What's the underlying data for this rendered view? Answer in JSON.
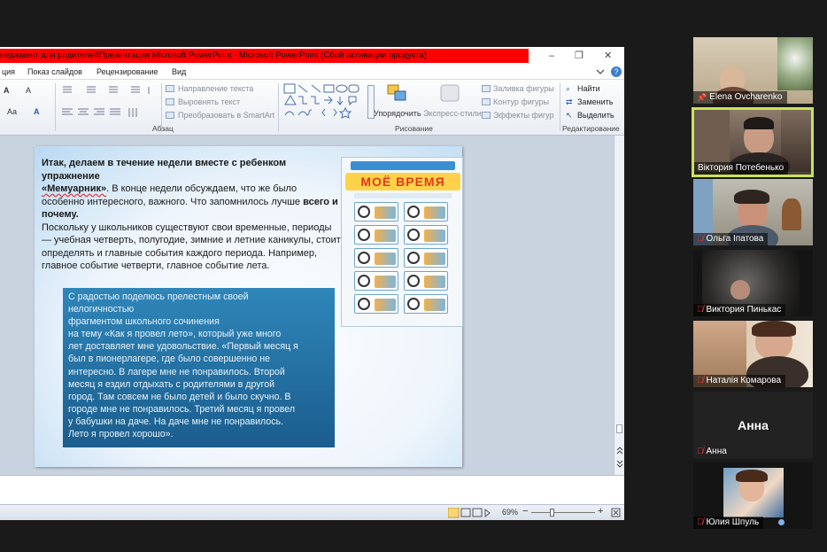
{
  "window": {
    "title": "неджмент для родителейПрезентация Microsoft PowerPoint  -  Microsoft PowerPoint (Сбой активации продукта)",
    "minimize": "–",
    "restore": "❐",
    "close": "✕",
    "help": "?"
  },
  "menu": {
    "items": [
      "ция",
      "Показ слайдов",
      "Рецензирование",
      "Вид"
    ]
  },
  "ribbon": {
    "text_direction": "Направление текста",
    "align_text": "Выровнять текст",
    "convert_smartart": "Преобразовать в SmartArt",
    "paragraph_group": "Абзац",
    "arrange": "Упорядочить",
    "quick_styles": "Экспресс-стили",
    "shape_fill": "Заливка фигуры",
    "shape_outline": "Контур фигуры",
    "shape_effects": "Эффекты фигур",
    "drawing_group": "Рисование",
    "find": "Найти",
    "replace": "Заменить",
    "select": "Выделить",
    "editing_group": "Редактирование",
    "font_size_increase": "A",
    "font_size_decrease": "A",
    "font_case": "Aa",
    "clear_format": "A"
  },
  "slide": {
    "para1_a": "Итак, делаем в течение недели вместе с ребенком упражнение",
    "para1_b": "«Мемуарник»",
    "para1_c": ". В конце недели обсуждаем, что же было особенно интересного, важного. Что запомнилось лучше",
    "para1_d": "всего и почему.",
    "para2": "Поскольку у школьников существуют свои временные, периоды — учебная четверть, полугодие, зимние и летние каникулы, стоит определять и главные события каждого периода. Например, главное событие четверти, главное событие лета.",
    "quote": [
      "С радостью поделюсь прелестным своей",
      "нелогичностью",
      "фрагментом школьного сочинения",
      "на тему «Как я провел лето», который уже много",
      "лет доставляет мне удовольствие. «Первый месяц я",
      "был в пионерлагере, где было совершенно не",
      "интересно. В лагере мне не понравилось. Второй",
      "месяц я ездил отдыхать с родителями в другой",
      "город. Там совсем не было детей и было скучно. В",
      "городе мне не понравилось. Третий месяц я провел",
      " у бабушки на даче. На даче мне не понравилось.",
      " Лето я провел хорошо»."
    ],
    "book_title": "МОЁ ВРЕМЯ"
  },
  "status": {
    "zoom": "69%",
    "zoom_out": "−",
    "zoom_in": "+"
  },
  "participants": [
    {
      "name": "Elena Ovcharenko",
      "icon": "pin-icon"
    },
    {
      "name": "Віктория Потебенько",
      "icon": "none"
    },
    {
      "name": "Ольга Іпатова",
      "icon": "muted-mic-icon"
    },
    {
      "name": "Виктория Пинькас",
      "icon": "muted-mic-icon"
    },
    {
      "name": "Наталія Комарова",
      "icon": "muted-mic-icon"
    },
    {
      "name": "Анна",
      "icon": "muted-mic-icon",
      "avatar_label": "Анна"
    },
    {
      "name": "Юлия Шпуль",
      "icon": "muted-mic-icon"
    }
  ],
  "colors": {
    "title_bar": "#ff0000",
    "active_speaker_border": "#c9e35a",
    "quote_box": "#2273a6",
    "muted": "#e03a3a"
  }
}
